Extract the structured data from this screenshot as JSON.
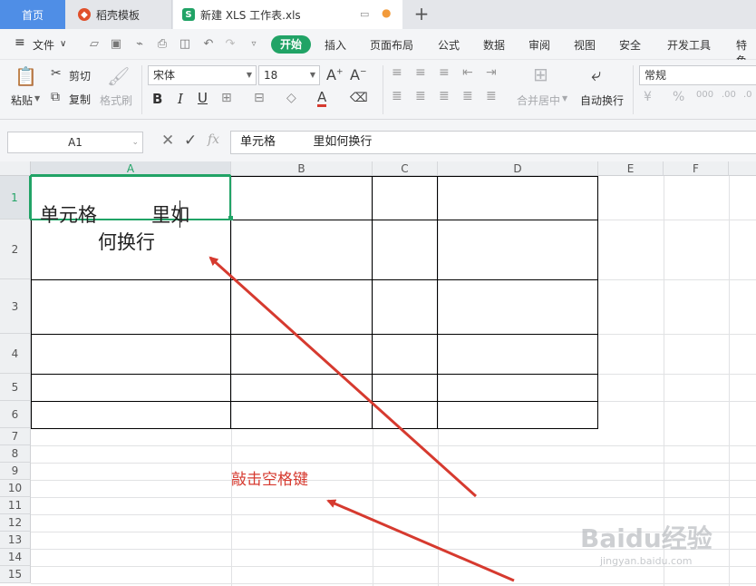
{
  "tabs": {
    "home": "首页",
    "template": "稻壳模板",
    "file": "新建 XLS 工作表.xls"
  },
  "menu": {
    "file": "文件",
    "items": [
      "开始",
      "插入",
      "页面布局",
      "公式",
      "数据",
      "审阅",
      "视图",
      "安全",
      "开发工具",
      "特色"
    ]
  },
  "ribbon": {
    "paste": "粘贴",
    "cut": "剪切",
    "copy": "复制",
    "format_painter": "格式刷",
    "font_name": "宋体",
    "font_size": "18",
    "bold": "B",
    "italic": "I",
    "underline": "U",
    "merge_center": "合并居中",
    "auto_wrap": "自动换行",
    "number_format": "常规"
  },
  "formula_bar": {
    "cell_ref": "A1",
    "fx": "fx",
    "content": "单元格          里如何换行"
  },
  "sheet": {
    "columns": [
      "A",
      "B",
      "C",
      "D",
      "E",
      "F"
    ],
    "rows": [
      "1",
      "2",
      "3",
      "4",
      "5",
      "6",
      "7",
      "8",
      "9",
      "10",
      "11",
      "12",
      "13",
      "14",
      "15"
    ],
    "a1_line1": "单元格         里如",
    "a1_line2": "何换行"
  },
  "annotation": {
    "text": "敲击空格键",
    "color": "#d63a2f"
  },
  "watermark": {
    "brand": "Baidu经验",
    "url": "jingyan.baidu.com"
  },
  "colors": {
    "accent_green": "#21a366",
    "home_tab_blue": "#4f8ee6"
  }
}
